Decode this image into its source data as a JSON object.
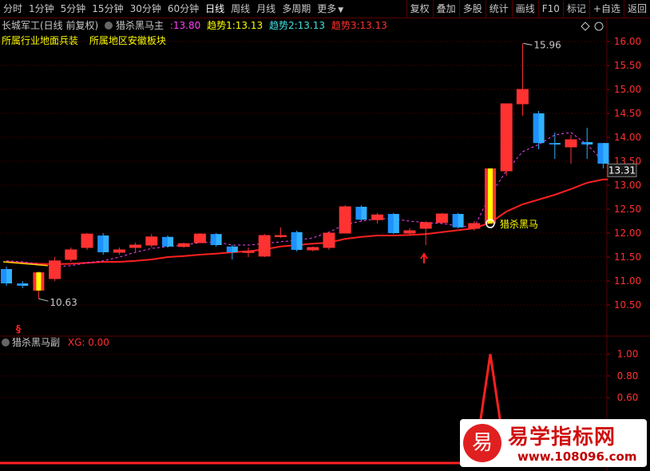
{
  "toolbar": {
    "periods": [
      "分时",
      "1分钟",
      "5分钟",
      "15分钟",
      "30分钟",
      "60分钟",
      "日线",
      "周线",
      "月线",
      "多周期",
      "更多"
    ],
    "active_period": "日线",
    "more_arrow": "▼",
    "actions": [
      "复权",
      "叠加",
      "多股",
      "统计",
      "画线",
      "F10",
      "标记",
      "+自选",
      "返回"
    ]
  },
  "header": {
    "stock": "长城军工(日线 前复权)",
    "indicator": "猎杀黑马主",
    "value_main": ":13.80",
    "trend1_label": "趋势1:",
    "trend1_value": "13.13",
    "trend2_label": "趋势2:",
    "trend2_value": "13.13",
    "trend3_label": "趋势3:",
    "trend3_value": "13.13"
  },
  "sector": {
    "industry": "所属行业地面兵装",
    "region": "所属地区安徽板块"
  },
  "sub": {
    "name": "猎杀黑马副",
    "xg": "XG: 0.00"
  },
  "annotations": {
    "high": "15.96",
    "low": "10.63",
    "signal": "猎杀黑马",
    "current_price": "13.31",
    "marker": "§"
  },
  "axis_main": [
    "16.00",
    "15.50",
    "15.00",
    "14.50",
    "14.00",
    "13.50",
    "13.00",
    "12.50",
    "12.00",
    "11.50",
    "11.00",
    "10.50"
  ],
  "axis_sub": [
    "1.00",
    "0.80",
    "0.60"
  ],
  "colors": {
    "up": "#ff3232",
    "down": "#1e90ff",
    "signal_bar": "#ffff00",
    "ma": "#ff2020",
    "grid": "#5a0000"
  },
  "chart_data": {
    "type": "candlestick",
    "ylim": [
      10.1,
      16.3
    ],
    "candles": [
      {
        "o": 11.25,
        "h": 11.3,
        "l": 10.9,
        "c": 10.95
      },
      {
        "o": 10.95,
        "h": 11.0,
        "l": 10.85,
        "c": 10.9
      },
      {
        "o": 10.8,
        "h": 11.2,
        "l": 10.63,
        "c": 11.18
      },
      {
        "o": 11.05,
        "h": 11.5,
        "l": 11.0,
        "c": 11.42
      },
      {
        "o": 11.45,
        "h": 11.7,
        "l": 11.4,
        "c": 11.65
      },
      {
        "o": 11.7,
        "h": 12.0,
        "l": 11.65,
        "c": 11.98
      },
      {
        "o": 11.95,
        "h": 12.0,
        "l": 11.55,
        "c": 11.6
      },
      {
        "o": 11.6,
        "h": 11.7,
        "l": 11.55,
        "c": 11.65
      },
      {
        "o": 11.7,
        "h": 11.8,
        "l": 11.6,
        "c": 11.75
      },
      {
        "o": 11.75,
        "h": 11.98,
        "l": 11.7,
        "c": 11.92
      },
      {
        "o": 11.92,
        "h": 11.95,
        "l": 11.7,
        "c": 11.72
      },
      {
        "o": 11.72,
        "h": 11.8,
        "l": 11.7,
        "c": 11.78
      },
      {
        "o": 11.8,
        "h": 12.0,
        "l": 11.8,
        "c": 11.98
      },
      {
        "o": 11.98,
        "h": 12.0,
        "l": 11.72,
        "c": 11.75
      },
      {
        "o": 11.72,
        "h": 11.75,
        "l": 11.45,
        "c": 11.6
      },
      {
        "o": 11.6,
        "h": 11.7,
        "l": 11.5,
        "c": 11.62
      },
      {
        "o": 11.52,
        "h": 11.98,
        "l": 11.5,
        "c": 11.95
      },
      {
        "o": 11.95,
        "h": 12.12,
        "l": 11.9,
        "c": 11.95
      },
      {
        "o": 12.02,
        "h": 12.05,
        "l": 11.62,
        "c": 11.65
      },
      {
        "o": 11.65,
        "h": 11.72,
        "l": 11.62,
        "c": 11.7
      },
      {
        "o": 11.7,
        "h": 12.02,
        "l": 11.65,
        "c": 12.0
      },
      {
        "o": 12.0,
        "h": 12.58,
        "l": 12.0,
        "c": 12.55
      },
      {
        "o": 12.55,
        "h": 12.58,
        "l": 12.25,
        "c": 12.28
      },
      {
        "o": 12.28,
        "h": 12.42,
        "l": 12.2,
        "c": 12.38
      },
      {
        "o": 12.4,
        "h": 12.42,
        "l": 11.98,
        "c": 12.0
      },
      {
        "o": 12.0,
        "h": 12.1,
        "l": 11.95,
        "c": 12.05
      },
      {
        "o": 12.1,
        "h": 12.25,
        "l": 11.75,
        "c": 12.22
      },
      {
        "o": 12.22,
        "h": 12.42,
        "l": 12.2,
        "c": 12.4
      },
      {
        "o": 12.4,
        "h": 12.42,
        "l": 12.1,
        "c": 12.12
      },
      {
        "o": 12.1,
        "h": 12.25,
        "l": 12.05,
        "c": 12.2
      },
      {
        "o": 12.2,
        "h": 13.35,
        "l": 12.2,
        "c": 13.35
      },
      {
        "o": 13.3,
        "h": 14.7,
        "l": 13.2,
        "c": 14.7
      },
      {
        "o": 14.7,
        "h": 15.96,
        "l": 14.45,
        "c": 15.0
      },
      {
        "o": 14.5,
        "h": 14.55,
        "l": 13.75,
        "c": 13.88
      },
      {
        "o": 13.88,
        "h": 14.1,
        "l": 13.55,
        "c": 13.85
      },
      {
        "o": 13.8,
        "h": 14.05,
        "l": 13.45,
        "c": 13.95
      },
      {
        "o": 13.9,
        "h": 14.2,
        "l": 13.55,
        "c": 13.85
      },
      {
        "o": 13.88,
        "h": 13.88,
        "l": 13.35,
        "c": 13.45
      }
    ],
    "ma": [
      11.4,
      11.38,
      11.36,
      11.35,
      11.36,
      11.38,
      11.4,
      11.4,
      11.42,
      11.45,
      11.5,
      11.52,
      11.55,
      11.57,
      11.6,
      11.62,
      11.66,
      11.72,
      11.75,
      11.78,
      11.8,
      11.88,
      11.92,
      11.95,
      11.95,
      11.96,
      11.98,
      12.02,
      12.06,
      12.1,
      12.22,
      12.45,
      12.6,
      12.7,
      12.8,
      12.92,
      13.05,
      13.12
    ],
    "signal_line": [
      11.42,
      11.4,
      11.35,
      11.3,
      11.32,
      11.38,
      11.42,
      11.5,
      11.6,
      11.68,
      11.72,
      11.75,
      11.8,
      11.82,
      11.75,
      11.75,
      11.78,
      11.82,
      11.85,
      11.9,
      12.02,
      12.18,
      12.25,
      12.3,
      12.3,
      12.25,
      12.22,
      12.2,
      12.15,
      12.12,
      12.8,
      13.3,
      13.7,
      13.85,
      14.05,
      14.1,
      13.85,
      13.5
    ],
    "sub_xg": {
      "ylim": [
        0.0,
        1.1
      ],
      "values": [
        0,
        0,
        0,
        0,
        0,
        0,
        0,
        0,
        0,
        0,
        0,
        0,
        0,
        0,
        0,
        0,
        0,
        0,
        0,
        0,
        0,
        0,
        0,
        0,
        0,
        0,
        0,
        0,
        0,
        0,
        1,
        0,
        0,
        0,
        0,
        0,
        0,
        0
      ]
    }
  }
}
